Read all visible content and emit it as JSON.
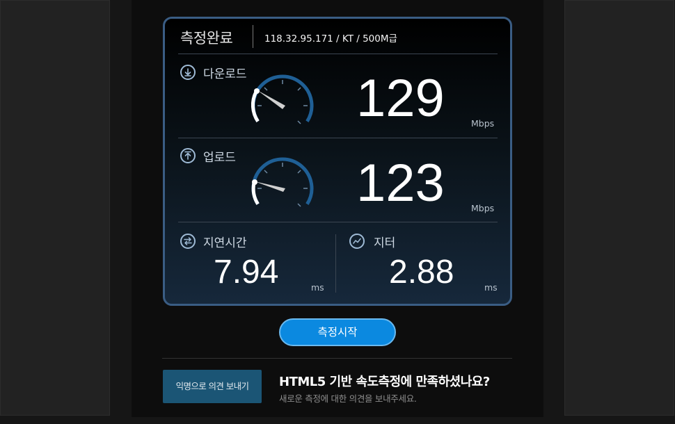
{
  "result": {
    "title": "측정완료",
    "connection_info": "118.32.95.171 / KT / 500M급"
  },
  "download": {
    "label": "다운로드",
    "value": "129",
    "unit": "Mbps",
    "icon": "download-icon"
  },
  "upload": {
    "label": "업로드",
    "value": "123",
    "unit": "Mbps",
    "icon": "upload-icon"
  },
  "latency": {
    "label": "지연시간",
    "value": "7.94",
    "unit": "ms",
    "icon": "swap-arrows-icon"
  },
  "jitter": {
    "label": "지터",
    "value": "2.88",
    "unit": "ms",
    "icon": "pulse-wave-icon"
  },
  "actions": {
    "start_label": "측정시작"
  },
  "feedback": {
    "button_label": "익명으로 의견 보내기",
    "title": "HTML5 기반 속도측정에 만족하셨나요?",
    "subtitle": "새로운 측정에 대한 의견을 보내주세요."
  },
  "colors": {
    "accent_blue": "#0b89e0",
    "card_border": "#3a5d84",
    "gauge_arc": "#1f5f95"
  }
}
